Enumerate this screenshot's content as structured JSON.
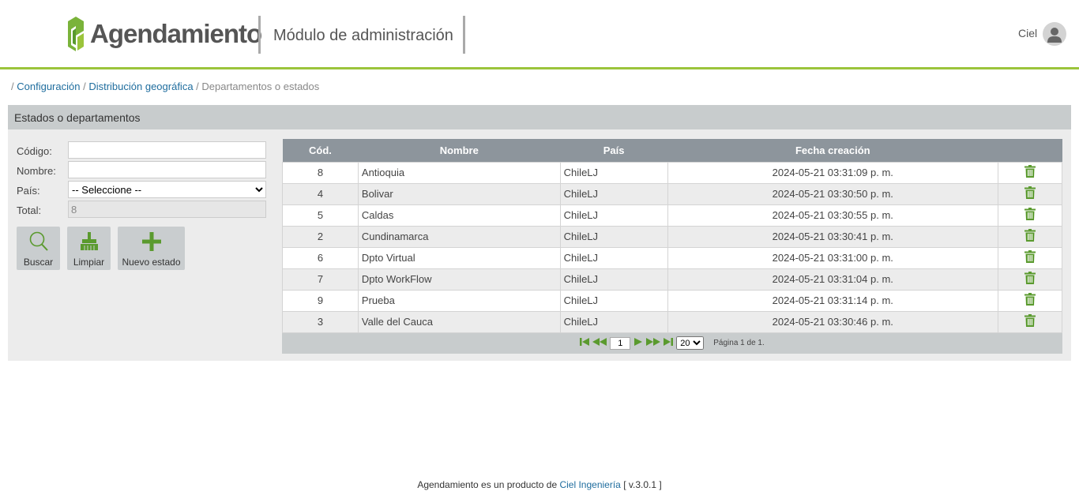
{
  "header": {
    "logo_text": "Agendamiento",
    "module_title": "Módulo de administración",
    "user_name": "Ciel"
  },
  "breadcrumb": {
    "items": [
      "Configuración",
      "Distribución geográfica"
    ],
    "current": "Departamentos o estados"
  },
  "panel": {
    "title": "Estados o departamentos"
  },
  "form": {
    "codigo_label": "Código:",
    "codigo_value": "",
    "nombre_label": "Nombre:",
    "nombre_value": "",
    "pais_label": "País:",
    "pais_selected": "-- Seleccione --",
    "total_label": "Total:",
    "total_value": "8"
  },
  "buttons": {
    "buscar": "Buscar",
    "limpiar": "Limpiar",
    "nuevo": "Nuevo estado"
  },
  "table": {
    "headers": [
      "Cód.",
      "Nombre",
      "País",
      "Fecha creación"
    ],
    "rows": [
      {
        "code": "8",
        "name": "Antioquia",
        "pais": "ChileLJ",
        "fecha": "2024-05-21 03:31:09 p. m."
      },
      {
        "code": "4",
        "name": "Bolivar",
        "pais": "ChileLJ",
        "fecha": "2024-05-21 03:30:50 p. m."
      },
      {
        "code": "5",
        "name": "Caldas",
        "pais": "ChileLJ",
        "fecha": "2024-05-21 03:30:55 p. m."
      },
      {
        "code": "2",
        "name": "Cundinamarca",
        "pais": "ChileLJ",
        "fecha": "2024-05-21 03:30:41 p. m."
      },
      {
        "code": "6",
        "name": "Dpto Virtual",
        "pais": "ChileLJ",
        "fecha": "2024-05-21 03:31:00 p. m."
      },
      {
        "code": "7",
        "name": "Dpto WorkFlow",
        "pais": "ChileLJ",
        "fecha": "2024-05-21 03:31:04 p. m."
      },
      {
        "code": "9",
        "name": "Prueba",
        "pais": "ChileLJ",
        "fecha": "2024-05-21 03:31:14 p. m."
      },
      {
        "code": "3",
        "name": "Valle del Cauca",
        "pais": "ChileLJ",
        "fecha": "2024-05-21 03:30:46 p. m."
      }
    ]
  },
  "pager": {
    "page": "1",
    "page_size": "20",
    "info": "Página 1 de 1."
  },
  "footer": {
    "prefix": "Agendamiento es un producto de",
    "company": "Ciel Ingeniería",
    "version": "[ v.3.0.1 ]"
  },
  "colors": {
    "accent": "#9bc43b",
    "icon_green": "#5a9a2e",
    "header_gray": "#8d959c"
  }
}
